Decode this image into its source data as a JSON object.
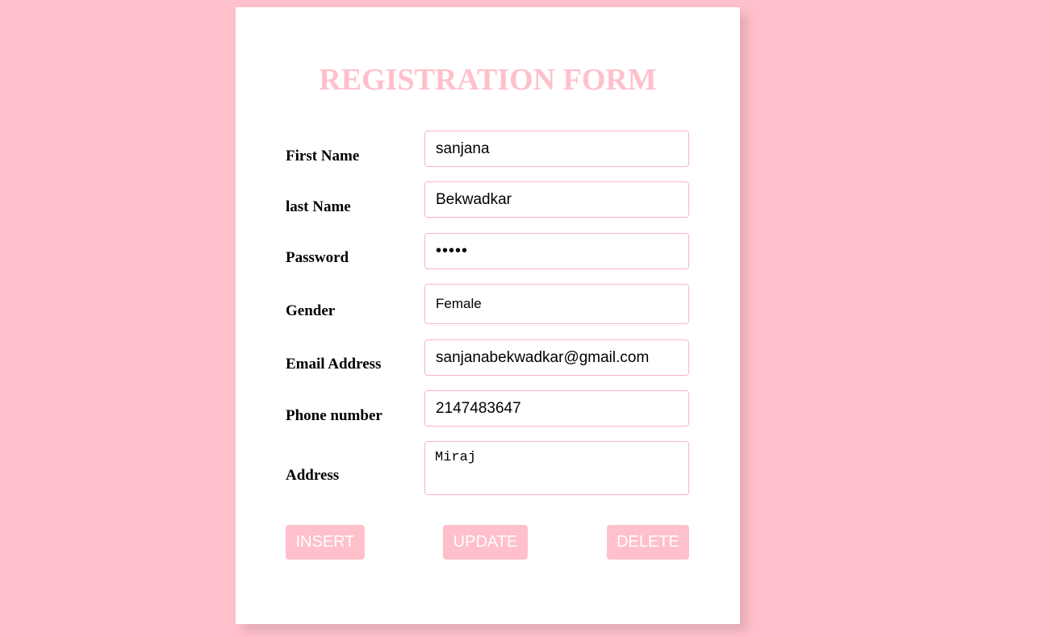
{
  "page": {
    "background_color": "#ffc0cb",
    "accent_color": "#ffc0cb",
    "field_border_color": "#f7b2d9"
  },
  "form": {
    "title": "REGISTRATION FORM",
    "fields": {
      "first_name": {
        "label": "First Name",
        "value": "sanjana"
      },
      "last_name": {
        "label": "last Name",
        "value": "Bekwadkar"
      },
      "password": {
        "label": "Password",
        "value": "•••••"
      },
      "gender": {
        "label": "Gender",
        "value": "Female"
      },
      "email": {
        "label": "Email Address",
        "value": "sanjanabekwadkar@gmail.com"
      },
      "phone": {
        "label": "Phone number",
        "value": "2147483647"
      },
      "address": {
        "label": "Address",
        "value": "Miraj"
      }
    },
    "buttons": {
      "insert": "INSERT",
      "update": "UPDATE",
      "delete": "DELETE"
    }
  }
}
